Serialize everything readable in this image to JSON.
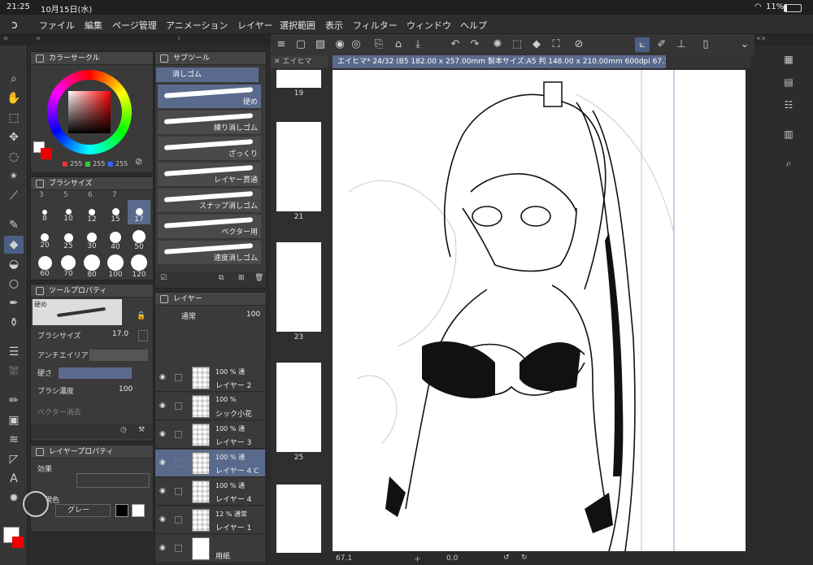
{
  "status": {
    "time": "21:25",
    "date": "10月15日(水)",
    "battery": "11%"
  },
  "menu": [
    "ファイル",
    "編集",
    "ページ管理",
    "アニメーション",
    "レイヤー",
    "選択範囲",
    "表示",
    "フィルター",
    "ウィンドウ",
    "ヘルプ"
  ],
  "color_circle": {
    "title": "カラーサークル",
    "r": "255",
    "g": "255",
    "b": "255"
  },
  "brush_size": {
    "title": "ブラシサイズ",
    "sizes": [
      "8",
      "10",
      "12",
      "15",
      "17",
      "20",
      "25",
      "30",
      "40",
      "50",
      "60",
      "70",
      "80",
      "100",
      "120"
    ],
    "top_row": [
      "3",
      "5",
      "6",
      "7"
    ],
    "selected": "17"
  },
  "tool_property": {
    "title": "ツールプロパティ",
    "tool": "硬め",
    "brush_size_label": "ブラシサイズ",
    "brush_size_value": "17.0",
    "antialias_label": "アンチエイリアス",
    "hardness_label": "硬さ",
    "density_label": "ブラシ濃度",
    "density_value": "100",
    "vector_erase_label": "ベクター消去"
  },
  "layer_property": {
    "title": "レイヤープロパティ",
    "effect_label": "効果",
    "color_label": "表現色",
    "color_value": "グレー"
  },
  "sub_tool": {
    "title": "サブツール",
    "group": "消しゴム",
    "items": [
      "硬め",
      "練り消しゴム",
      "ざっくり",
      "レイヤー貫通",
      "スナップ消しゴム",
      "ベクター用",
      "速度消しゴム"
    ]
  },
  "layers": {
    "title": "レイヤー",
    "blend": "通常",
    "opacity": "100",
    "items": [
      {
        "l1": "100 % 通",
        "l2": "レイヤー 2"
      },
      {
        "l1": "100 %",
        "l2": "シック小花"
      },
      {
        "l1": "100 % 通",
        "l2": "レイヤー 3"
      },
      {
        "l1": "100 % 通",
        "l2": "レイヤー 4 C"
      },
      {
        "l1": "100 % 通",
        "l2": "レイヤー 4"
      },
      {
        "l1": "12 % 通常",
        "l2": "レイヤー 1"
      },
      {
        "l1": "",
        "l2": "用紙"
      }
    ]
  },
  "pages": {
    "tab": "エイヒマ",
    "labels": [
      "19",
      "21",
      "23",
      "25"
    ]
  },
  "document_tab": "エイヒマ* 24/32 (B5 182.00 x 257.00mm 製本サイズ:A5 判 148.00 x 210.00mm 600dpi 67.1%)",
  "bottom": {
    "zoom": "67.1",
    "angle": "0.0"
  },
  "accent": "#4b5f86"
}
